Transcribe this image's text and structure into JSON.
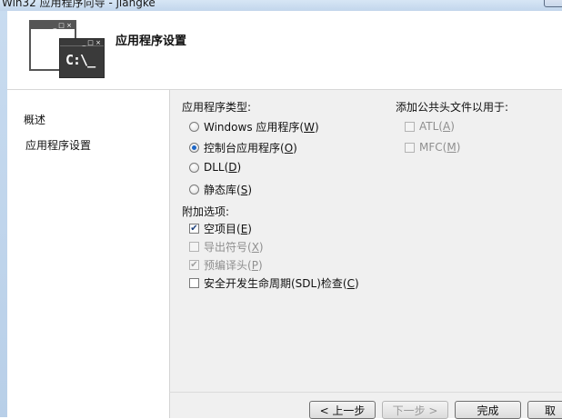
{
  "window": {
    "title": "Win32 应用程序向导 - jiangke"
  },
  "header": {
    "logo_text": "C:\\_",
    "logo_controls": "_ □ ×",
    "title": "应用程序设置"
  },
  "nav": {
    "items": [
      {
        "label": "概述"
      },
      {
        "label": "应用程序设置"
      }
    ]
  },
  "app_type": {
    "label": "应用程序类型:",
    "options": [
      {
        "label": "Windows 应用程序(",
        "key": "W",
        "selected": false
      },
      {
        "label": "控制台应用程序(",
        "key": "O",
        "selected": true
      },
      {
        "label": "DLL(",
        "key": "D",
        "selected": false
      },
      {
        "label": "静态库(",
        "key": "S",
        "selected": false
      }
    ]
  },
  "additional": {
    "label": "附加选项:",
    "options": [
      {
        "label": "空项目(",
        "key": "E",
        "checked": true,
        "enabled": true
      },
      {
        "label": "导出符号(",
        "key": "X",
        "checked": false,
        "enabled": false
      },
      {
        "label": "预编译头(",
        "key": "P",
        "checked": true,
        "enabled": false
      },
      {
        "label": "安全开发生命周期(SDL)检查(",
        "key": "C",
        "checked": false,
        "enabled": true
      }
    ]
  },
  "common_headers": {
    "label": "添加公共头文件以用于:",
    "options": [
      {
        "label": "ATL(",
        "key": "A",
        "checked": false,
        "enabled": false
      },
      {
        "label": "MFC(",
        "key": "M",
        "checked": false,
        "enabled": false
      }
    ]
  },
  "buttons": {
    "prev": "< 上一步",
    "next": "下一步 >",
    "finish": "完成",
    "cancel": "取"
  },
  "icons": {
    "check": "✔",
    "close_paren": ")"
  }
}
